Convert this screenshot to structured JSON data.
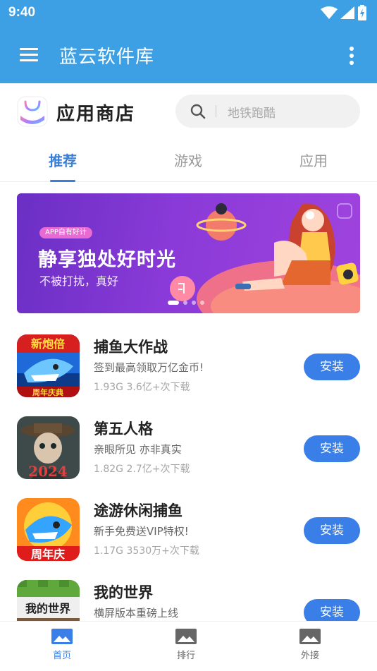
{
  "status_bar": {
    "time": "9:40"
  },
  "app_bar": {
    "title": "蓝云软件库"
  },
  "store": {
    "title": "应用商店",
    "search_placeholder": "地铁跑酷"
  },
  "tabs": [
    {
      "label": "推荐",
      "active": true
    },
    {
      "label": "游戏",
      "active": false
    },
    {
      "label": "应用",
      "active": false
    }
  ],
  "banner": {
    "tag": "APP自有好计",
    "title": "静享独处好时光",
    "subtitle": "不被打扰，真好",
    "slide_count": 4,
    "active_slide": 1
  },
  "apps": [
    {
      "name": "捕鱼大作战",
      "desc": "签到最高领取万亿金币!",
      "size": "1.93G",
      "downloads": "3.6亿+次下载",
      "install_label": "安装",
      "icon_caption": "新炮倍",
      "icon_badge": "周年庆典"
    },
    {
      "name": "第五人格",
      "desc": "亲眼所见 亦非真实",
      "size": "1.82G",
      "downloads": "2.7亿+次下载",
      "install_label": "安装",
      "icon_badge": "2024"
    },
    {
      "name": "途游休闲捕鱼",
      "desc": "新手免费送VIP特权!",
      "size": "1.17G",
      "downloads": "3530万+次下载",
      "install_label": "安装",
      "icon_badge": "周年庆"
    },
    {
      "name": "我的世界",
      "desc": "横屏版本重磅上线",
      "size": "",
      "downloads": "",
      "install_label": "安装",
      "icon_badge": "我的世界"
    }
  ],
  "bottom_nav": [
    {
      "label": "首页",
      "icon": "image-icon",
      "active": true
    },
    {
      "label": "排行",
      "icon": "image-icon",
      "active": false
    },
    {
      "label": "外接",
      "icon": "image-icon",
      "active": false
    }
  ],
  "colors": {
    "primary": "#3ea0e4",
    "accent": "#3a7fe8",
    "banner": "#8a3ad8"
  }
}
